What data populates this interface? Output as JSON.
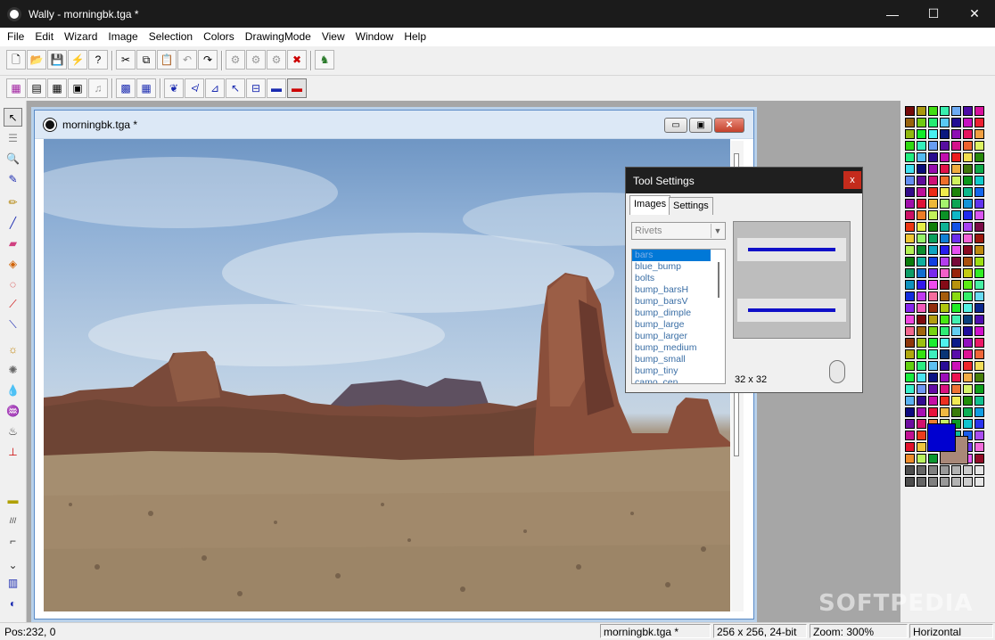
{
  "window": {
    "title": "Wally - morningbk.tga *",
    "controls": {
      "minimize": "—",
      "maximize": "☐",
      "close": "✕"
    }
  },
  "menu": [
    "File",
    "Edit",
    "Wizard",
    "Image",
    "Selection",
    "Colors",
    "DrawingMode",
    "View",
    "Window",
    "Help"
  ],
  "toolbar1": [
    {
      "name": "new-button",
      "glyph": "🗋"
    },
    {
      "name": "open-button",
      "glyph": "📂"
    },
    {
      "name": "save-button",
      "glyph": "💾"
    },
    {
      "name": "wizard-button",
      "glyph": "⚡"
    },
    {
      "name": "help-button",
      "glyph": "?"
    },
    {
      "name": "cut-button",
      "glyph": "✂"
    },
    {
      "name": "copy-button",
      "glyph": "⧉"
    },
    {
      "name": "paste-button",
      "glyph": "📋"
    },
    {
      "name": "undo-button",
      "glyph": "↶"
    },
    {
      "name": "redo-button",
      "glyph": "↷"
    },
    {
      "name": "tool-a-button",
      "glyph": "⚙"
    },
    {
      "name": "tool-b-button",
      "glyph": "⚙"
    },
    {
      "name": "tool-c-button",
      "glyph": "⚙"
    },
    {
      "name": "pick-button",
      "glyph": "✖"
    },
    {
      "name": "run-button",
      "glyph": "♞"
    }
  ],
  "toolbar2": [
    {
      "name": "palette-view-button",
      "glyph": "▦"
    },
    {
      "name": "tool-view-button",
      "glyph": "▤"
    },
    {
      "name": "grid-button",
      "glyph": "▦"
    },
    {
      "name": "preview-button",
      "glyph": "▣"
    },
    {
      "name": "sound-button",
      "glyph": "♫"
    },
    {
      "name": "tile-grid-button",
      "glyph": "▩"
    },
    {
      "name": "tile-button",
      "glyph": "▦"
    },
    {
      "name": "mode-a-button",
      "glyph": "❦"
    },
    {
      "name": "mode-b-button",
      "glyph": "≮"
    },
    {
      "name": "mode-c-button",
      "glyph": "⊿"
    },
    {
      "name": "mode-d-button",
      "glyph": "↖"
    },
    {
      "name": "mode-e-button",
      "glyph": "⊟"
    },
    {
      "name": "mode-f-button",
      "glyph": "▬"
    },
    {
      "name": "mode-g-button",
      "glyph": "▬"
    }
  ],
  "tools": [
    {
      "name": "select-tool",
      "glyph": "↖"
    },
    {
      "name": "marquee-tool",
      "glyph": "☰"
    },
    {
      "name": "zoom-tool",
      "glyph": "🔍"
    },
    {
      "name": "eyedropper-tool",
      "glyph": "✎"
    },
    {
      "name": "pencil-tool",
      "glyph": "✏"
    },
    {
      "name": "brush-tool",
      "glyph": "╱"
    },
    {
      "name": "eraser-tool",
      "glyph": "▰"
    },
    {
      "name": "fill-tool",
      "glyph": "◈"
    },
    {
      "name": "spray-tool",
      "glyph": "◌"
    },
    {
      "name": "line-tool",
      "glyph": "⟋"
    },
    {
      "name": "gradient-tool",
      "glyph": "⟍"
    },
    {
      "name": "lighten-tool",
      "glyph": "☼"
    },
    {
      "name": "darken-tool",
      "glyph": "✺"
    },
    {
      "name": "drop-tool",
      "glyph": "💧"
    },
    {
      "name": "comb-tool",
      "glyph": "♒"
    },
    {
      "name": "flood-tool",
      "glyph": "♨"
    },
    {
      "name": "stamp-tool",
      "glyph": "⊥"
    },
    {
      "name": "rivet-tool",
      "glyph": "▬"
    },
    {
      "name": "scratch-tool",
      "glyph": "///"
    },
    {
      "name": "gun-tool",
      "glyph": "⌐"
    },
    {
      "name": "bullet-tool",
      "glyph": "⌄"
    },
    {
      "name": "flag-tool",
      "glyph": "▥"
    },
    {
      "name": "patch-tool",
      "glyph": "◐"
    }
  ],
  "image_window": {
    "title": "morningbk.tga *",
    "buttons": {
      "minimize": "▭",
      "restore": "▣",
      "close": "✕"
    }
  },
  "tool_settings": {
    "title": "Tool Settings",
    "close": "x",
    "tabs": [
      "Images",
      "Settings"
    ],
    "category": "Rivets",
    "items": [
      "bars",
      "blue_bump",
      "bolts",
      "bump_barsH",
      "bump_barsV",
      "bump_dimple",
      "bump_large",
      "bump_larger",
      "bump_medium",
      "bump_small",
      "bump_tiny",
      "camo_cen"
    ],
    "selected_index": 0,
    "preview_size": "32 x 32"
  },
  "palette": {
    "foreground": "#0000d0",
    "background": "#a98878"
  },
  "status": {
    "pos": "Pos:232,  0",
    "file": "morningbk.tga *",
    "size": "256 x 256, 24-bit",
    "zoom": "Zoom: 300%",
    "orientation": "Horizontal"
  },
  "watermark": "SOFTPEDIA"
}
